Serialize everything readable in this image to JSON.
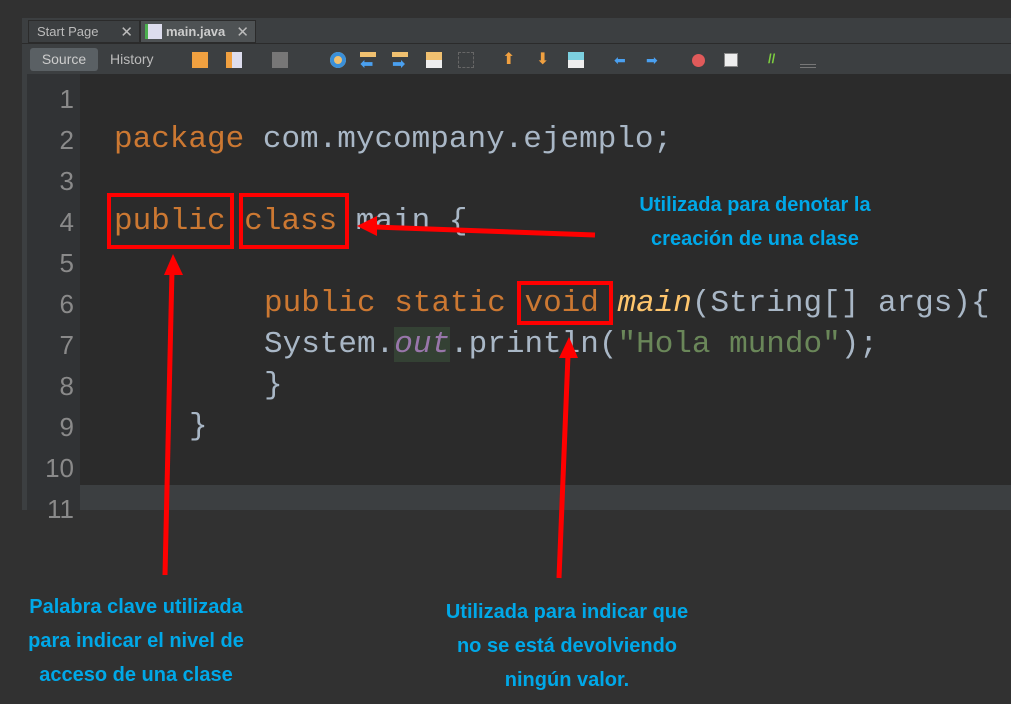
{
  "tabs": [
    {
      "label": "Start Page",
      "active": false
    },
    {
      "label": "main.java",
      "active": true
    }
  ],
  "toolbar": {
    "source": "Source",
    "history": "History"
  },
  "line_numbers": [
    "1",
    "2",
    "3",
    "4",
    "5",
    "6",
    "7",
    "8",
    "9",
    "10",
    "11"
  ],
  "code": {
    "l2": {
      "kw": "package",
      "rest": " com.mycompany.ejemplo;"
    },
    "l4": {
      "kw1": "public",
      "kw2": "class",
      "rest": " main {"
    },
    "l6": {
      "kw1": "public",
      "kw2": "static",
      "kw3": "void",
      "fn": "main",
      "rest": "(String[] args){"
    },
    "l7": {
      "a": "System.",
      "field": "out",
      "b": ".println(",
      "str": "\"Hola mundo\"",
      "c": ");"
    },
    "l8": "}",
    "l9": "}"
  },
  "annotations": {
    "class_note": [
      "Utilizada para denotar la",
      "creación de una clase"
    ],
    "public_note": [
      "Palabra clave utilizada",
      "para indicar el nivel de",
      "acceso de una clase"
    ],
    "void_note": [
      "Utilizada para indicar que",
      "no se está devolviendo",
      "ningún valor."
    ]
  },
  "colors": {
    "annotation": "#00a8e8",
    "highlight": "#ff0000",
    "keyword": "#cc7832",
    "string": "#6a8759"
  }
}
